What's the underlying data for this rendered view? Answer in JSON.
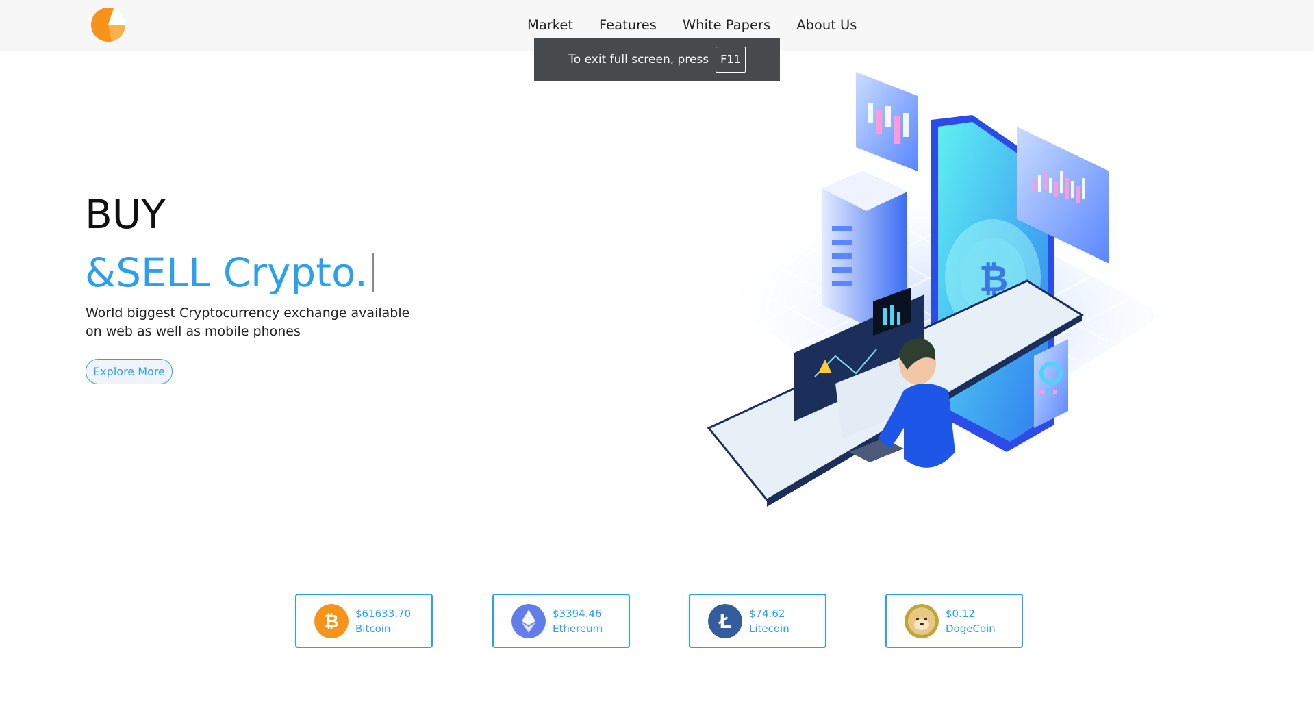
{
  "nav": {
    "links": [
      "Market",
      "Features",
      "White Papers",
      "About Us"
    ]
  },
  "fullscreen_notice": {
    "text": "To exit full screen, press",
    "key": "F11"
  },
  "hero": {
    "line1": "BUY",
    "line2": "&SELL Crypto.",
    "description": "World biggest Cryptocurrency exchange available on web as well as mobile phones",
    "button_label": "Explore More"
  },
  "coins": [
    {
      "price": "$61633.70",
      "name": "Bitcoin",
      "icon": "bitcoin-icon",
      "color": "#f7931a"
    },
    {
      "price": "$3394.46",
      "name": "Ethereum",
      "icon": "ethereum-icon",
      "color": "#627eea"
    },
    {
      "price": "$74.62",
      "name": "Litecoin",
      "icon": "litecoin-icon",
      "color": "#345d9d"
    },
    {
      "price": "$0.12",
      "name": "DogeCoin",
      "icon": "dogecoin-icon",
      "color": "#c2a633"
    }
  ],
  "colors": {
    "accent": "#2ba0ef",
    "logo_orange": "#f7931a",
    "toast_bg": "#47494d"
  }
}
